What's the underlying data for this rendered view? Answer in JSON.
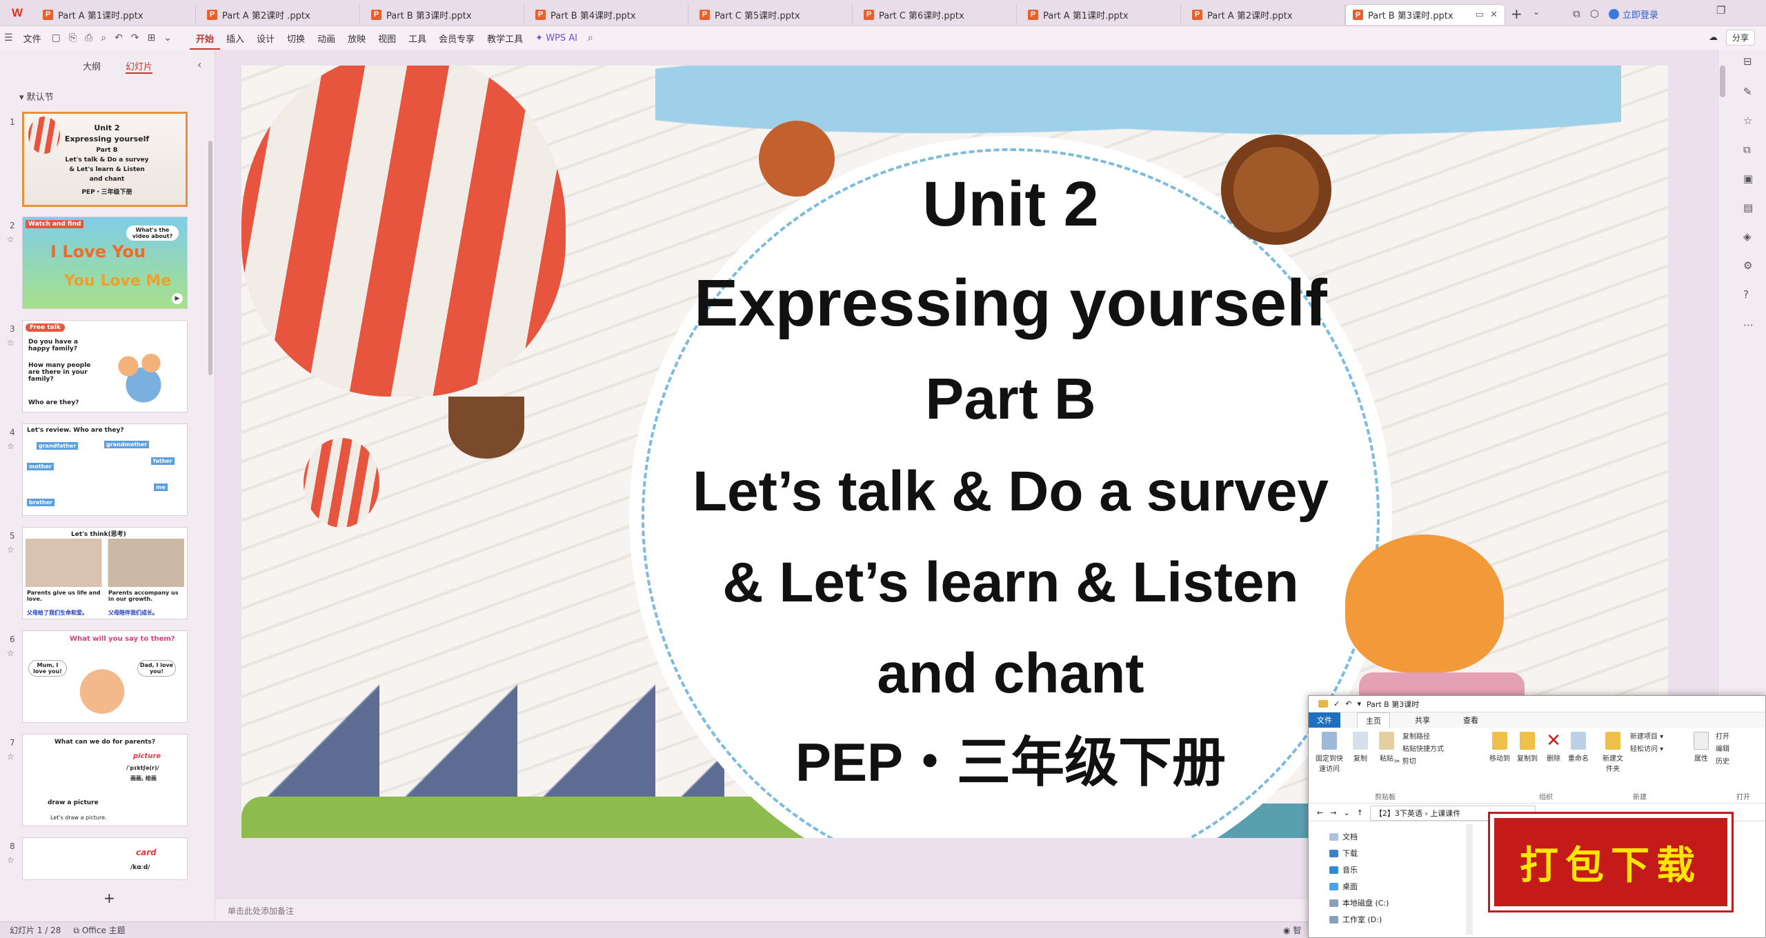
{
  "tabs": [
    {
      "title": "Part  A 第1课时.pptx"
    },
    {
      "title": "Part  A 第2课时 .pptx"
    },
    {
      "title": "Part  B 第3课时.pptx"
    },
    {
      "title": "Part  B 第4课时.pptx"
    },
    {
      "title": "Part  C 第5课时.pptx"
    },
    {
      "title": "Part  C 第6课时.pptx"
    },
    {
      "title": "Part  A 第1课时.pptx"
    },
    {
      "title": "Part  A 第2课时.pptx"
    },
    {
      "title": "Part  B 第3课时.pptx"
    }
  ],
  "header": {
    "login": "立即登录",
    "share": "分享"
  },
  "ribbon": {
    "file": "文件",
    "items": [
      "开始",
      "插入",
      "设计",
      "切换",
      "动画",
      "放映",
      "视图",
      "工具",
      "会员专享",
      "教学工具",
      "WPS AI"
    ]
  },
  "panel": {
    "tab_outline": "大纲",
    "tab_slides": "幻灯片",
    "section": "默认节",
    "slides": [
      {
        "num": "1",
        "lines": [
          "Unit 2",
          "Expressing yourself",
          "Part B",
          "Let's talk & Do a survey",
          "& Let's learn & Listen",
          "and chant",
          "PEP・三年级下册"
        ]
      },
      {
        "num": "2",
        "lines": [
          "Watch and find",
          "I Love You",
          "You Love Me",
          "What's the video about?"
        ]
      },
      {
        "num": "3",
        "lines": [
          "Free talk",
          "Do you have a happy family?",
          "How many people are there in your family?",
          "Who are they?"
        ]
      },
      {
        "num": "4",
        "lines": [
          "Let's review.  Who are they?",
          "grandfather",
          "grandmother",
          "mother",
          "father",
          "brother",
          "me"
        ]
      },
      {
        "num": "5",
        "lines": [
          "Let's think(思考)",
          "Parents give us life and love.",
          "Parents accompany us in our growth.",
          "父母给了我们生命和爱。",
          "父母陪伴我们成长。"
        ]
      },
      {
        "num": "6",
        "lines": [
          "What will you say to them?",
          "Mum, I love you!",
          "Dad, I love you!"
        ]
      },
      {
        "num": "7",
        "lines": [
          "What can we do for parents?",
          "picture",
          "/ˈpɪktʃə(r)/",
          "画画, 绘画",
          "draw a picture",
          "Let's draw a picture."
        ]
      },
      {
        "num": "8",
        "lines": [
          "card",
          "/kɑːd/"
        ]
      }
    ]
  },
  "slide": {
    "line1": "Unit 2",
    "line2": "Expressing yourself",
    "line3": "Part B",
    "line4": "Let’s talk & Do a survey",
    "line5": "& Let’s learn & Listen",
    "line6": "and chant",
    "line7": "PEP・三年级下册"
  },
  "notes_placeholder": "单击此处添加备注",
  "status": {
    "slide_info": "幻灯片 1 / 28",
    "theme": "Office 主题",
    "right_text": "智"
  },
  "explorer": {
    "title": "Part  B 第3课时",
    "tabs": [
      "文件",
      "主页",
      "共享",
      "查看"
    ],
    "buttons": [
      "固定到快速访问",
      "复制",
      "粘贴",
      "复制路径",
      "粘贴快捷方式",
      "剪切",
      "移动到",
      "复制到",
      "删除",
      "重命名",
      "新建文件夹",
      "新建项目",
      "轻松访问",
      "属性",
      "打开",
      "编辑",
      "历史"
    ],
    "groups": [
      "剪贴板",
      "组织",
      "新建",
      "打开"
    ],
    "path": "【2】3下英语  ›  上课课件",
    "tree": [
      "文档",
      "下载",
      "音乐",
      "桌面",
      "本地磁盘 (C:)",
      "工作室 (D:)"
    ]
  },
  "download_stamp": "打包下载"
}
